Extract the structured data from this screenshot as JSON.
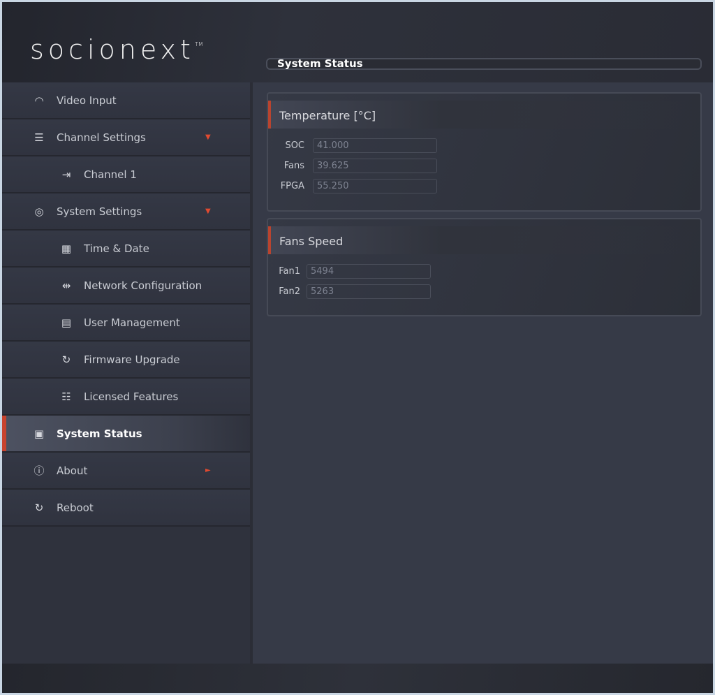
{
  "logo": {
    "text": "socionext",
    "tm": "TM"
  },
  "page_title": "System Status",
  "sidebar": {
    "items": [
      {
        "label": "Video Input",
        "icon": "gauge-icon",
        "glyph": "◠",
        "level": 1
      },
      {
        "label": "Channel Settings",
        "icon": "sliders-icon",
        "glyph": "☰",
        "level": 1,
        "arrow": "▼"
      },
      {
        "label": "Channel 1",
        "icon": "input-icon",
        "glyph": "⇥",
        "level": 2
      },
      {
        "label": "System Settings",
        "icon": "user-icon",
        "glyph": "◎",
        "level": 1,
        "arrow": "▼"
      },
      {
        "label": "Time & Date",
        "icon": "calendar-clock-icon",
        "glyph": "▦",
        "level": 2
      },
      {
        "label": "Network Configuration",
        "icon": "network-sliders-icon",
        "glyph": "⇹",
        "level": 2
      },
      {
        "label": "User Management",
        "icon": "user-box-icon",
        "glyph": "▤",
        "level": 2
      },
      {
        "label": "Firmware Upgrade",
        "icon": "refresh-icon",
        "glyph": "↻",
        "level": 2
      },
      {
        "label": "Licensed Features",
        "icon": "checklist-icon",
        "glyph": "☷",
        "level": 2
      },
      {
        "label": "System Status",
        "icon": "monitor-pulse-icon",
        "glyph": "▣",
        "level": 1,
        "active": true
      },
      {
        "label": "About",
        "icon": "info-icon",
        "glyph": "ⓘ",
        "level": 1,
        "arrow": "►"
      },
      {
        "label": "Reboot",
        "icon": "reboot-icon",
        "glyph": "↻",
        "level": 1
      }
    ]
  },
  "temperature": {
    "title": "Temperature [°C]",
    "rows": [
      {
        "label": "SOC",
        "value": "41.000"
      },
      {
        "label": "Fans",
        "value": "39.625"
      },
      {
        "label": "FPGA",
        "value": "55.250"
      }
    ]
  },
  "fans": {
    "title": "Fans Speed",
    "rows": [
      {
        "label": "Fan1",
        "value": "5494"
      },
      {
        "label": "Fan2",
        "value": "5263"
      }
    ]
  },
  "colors": {
    "accent": "#c8432e",
    "background": "#363a47"
  }
}
